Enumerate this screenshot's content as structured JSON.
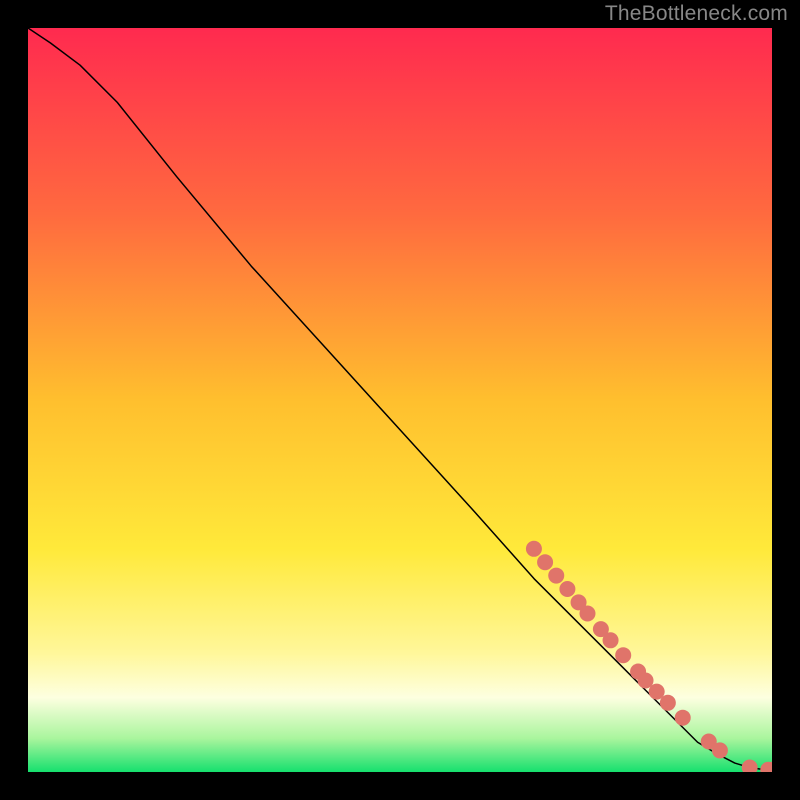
{
  "watermark": "TheBottleneck.com",
  "chart_data": {
    "type": "line",
    "title": "",
    "xlabel": "",
    "ylabel": "",
    "xlim": [
      0,
      100
    ],
    "ylim": [
      0,
      100
    ],
    "grid": false,
    "legend": false,
    "background": {
      "kind": "vertical-gradient",
      "note": "top red → orange → yellow → pale yellow → thin green stripe at bottom",
      "stops": [
        {
          "pos": 0.0,
          "color": "#ff2a4f"
        },
        {
          "pos": 0.25,
          "color": "#ff6a3f"
        },
        {
          "pos": 0.5,
          "color": "#ffbf2e"
        },
        {
          "pos": 0.7,
          "color": "#ffe93a"
        },
        {
          "pos": 0.84,
          "color": "#fff79a"
        },
        {
          "pos": 0.9,
          "color": "#fdffe0"
        },
        {
          "pos": 0.955,
          "color": "#a9f59d"
        },
        {
          "pos": 1.0,
          "color": "#16e06e"
        }
      ]
    },
    "series": [
      {
        "name": "curve",
        "style": "line",
        "color": "#000000",
        "width": 1.5,
        "x": [
          0,
          3,
          7,
          12,
          20,
          30,
          40,
          50,
          60,
          68,
          72,
          74,
          76,
          78,
          80,
          82,
          84,
          86,
          88,
          90,
          92.5,
          95,
          97,
          99,
          100
        ],
        "y": [
          100,
          98,
          95,
          90,
          80,
          68,
          57,
          46,
          35,
          26,
          22,
          20,
          18,
          16,
          14,
          12,
          10,
          8,
          6,
          4,
          2.5,
          1.2,
          0.6,
          0.3,
          0.3
        ]
      },
      {
        "name": "markers",
        "style": "points",
        "color": "#e0746a",
        "radius": 8,
        "points": [
          {
            "x": 68.0,
            "y": 30.0
          },
          {
            "x": 69.5,
            "y": 28.2
          },
          {
            "x": 71.0,
            "y": 26.4
          },
          {
            "x": 72.5,
            "y": 24.6
          },
          {
            "x": 74.0,
            "y": 22.8
          },
          {
            "x": 75.2,
            "y": 21.3
          },
          {
            "x": 77.0,
            "y": 19.2
          },
          {
            "x": 78.3,
            "y": 17.7
          },
          {
            "x": 80.0,
            "y": 15.7
          },
          {
            "x": 82.0,
            "y": 13.5
          },
          {
            "x": 83.0,
            "y": 12.3
          },
          {
            "x": 84.5,
            "y": 10.8
          },
          {
            "x": 86.0,
            "y": 9.3
          },
          {
            "x": 88.0,
            "y": 7.3
          },
          {
            "x": 91.5,
            "y": 4.1
          },
          {
            "x": 93.0,
            "y": 2.9
          },
          {
            "x": 97.0,
            "y": 0.6
          },
          {
            "x": 99.5,
            "y": 0.3
          },
          {
            "x": 100.0,
            "y": 0.3
          }
        ]
      }
    ]
  }
}
